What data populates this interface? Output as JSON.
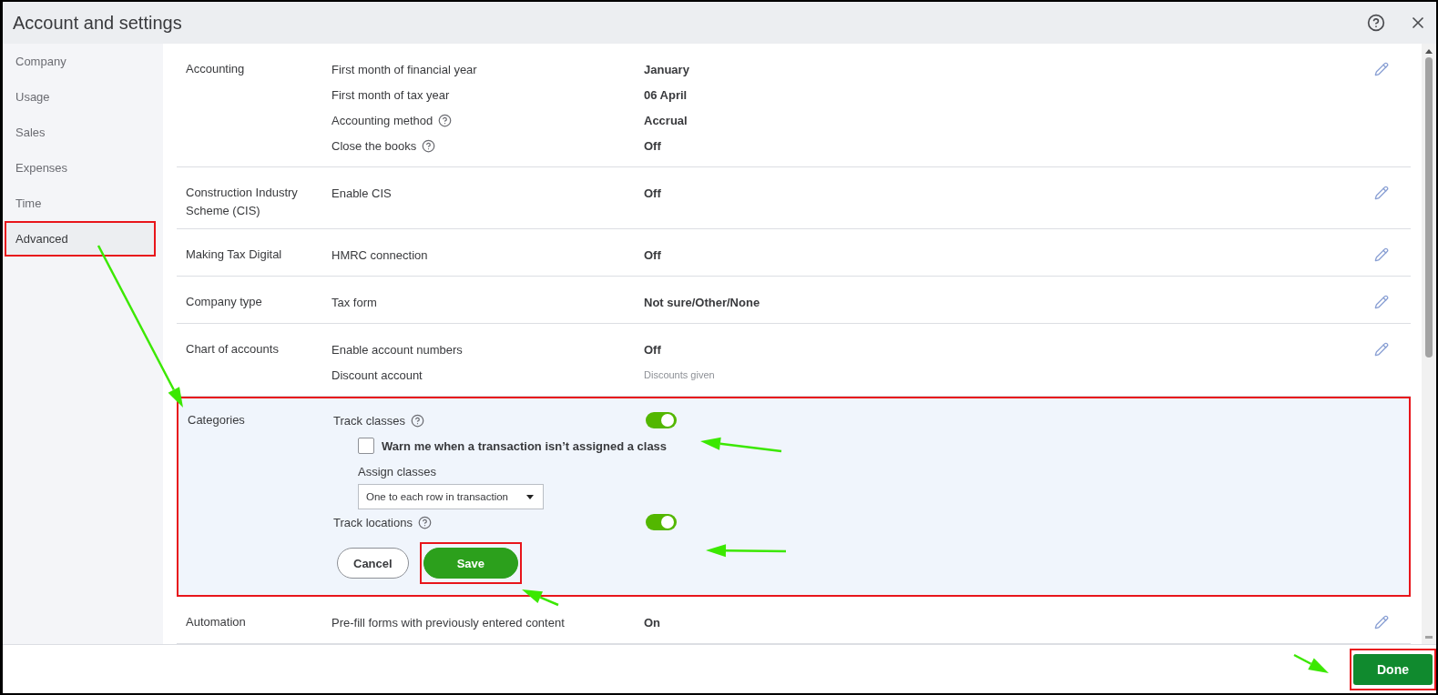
{
  "window": {
    "title": "Account and settings"
  },
  "sidebar": {
    "items": [
      {
        "label": "Company",
        "selected": false,
        "highlighted": false
      },
      {
        "label": "Usage",
        "selected": false,
        "highlighted": false
      },
      {
        "label": "Sales",
        "selected": false,
        "highlighted": false
      },
      {
        "label": "Expenses",
        "selected": false,
        "highlighted": false
      },
      {
        "label": "Time",
        "selected": false,
        "highlighted": false
      },
      {
        "label": "Advanced",
        "selected": true,
        "highlighted": true
      }
    ]
  },
  "sections": [
    {
      "kind": "info",
      "title": "Accounting",
      "editable": true,
      "highlighted": false,
      "rows": [
        {
          "label": "First month of financial year",
          "help": false,
          "value": "January",
          "muted": false
        },
        {
          "label": "First month of tax year",
          "help": false,
          "value": "06 April",
          "muted": false
        },
        {
          "label": "Accounting method",
          "help": true,
          "value": "Accrual",
          "muted": false
        },
        {
          "label": "Close the books",
          "help": true,
          "value": "Off",
          "muted": false
        }
      ]
    },
    {
      "kind": "info",
      "title": "Construction Industry Scheme (CIS)",
      "editable": true,
      "highlighted": false,
      "rows": [
        {
          "label": "Enable CIS",
          "help": false,
          "value": "Off",
          "muted": false
        }
      ]
    },
    {
      "kind": "info",
      "title": "Making Tax Digital",
      "editable": true,
      "highlighted": false,
      "rows": [
        {
          "label": "HMRC connection",
          "help": false,
          "value": "Off",
          "muted": false
        }
      ]
    },
    {
      "kind": "info",
      "title": "Company type",
      "editable": true,
      "highlighted": false,
      "rows": [
        {
          "label": "Tax form",
          "help": false,
          "value": "Not sure/Other/None",
          "muted": false
        }
      ]
    },
    {
      "kind": "info",
      "title": "Chart of accounts",
      "editable": true,
      "highlighted": false,
      "rows": [
        {
          "label": "Enable account numbers",
          "help": false,
          "value": "Off",
          "muted": false
        },
        {
          "label": "Discount account",
          "help": false,
          "value": "Discounts given",
          "muted": true
        }
      ]
    },
    {
      "kind": "form",
      "title": "Categories",
      "editable": false,
      "highlighted": true,
      "fields": [
        {
          "kind": "toggle",
          "label": "Track classes",
          "help": true,
          "on": true
        },
        {
          "kind": "checkbox",
          "label": "Warn me when a transaction isn’t assigned a class",
          "checked": false
        },
        {
          "kind": "caption",
          "label": "Assign classes"
        },
        {
          "kind": "select",
          "value": "One to each row in transaction"
        },
        {
          "kind": "toggle",
          "label": "Track locations",
          "help": true,
          "on": true
        }
      ],
      "buttons": [
        {
          "label": "Cancel",
          "kind": "secondary",
          "highlighted": false
        },
        {
          "label": "Save",
          "kind": "primary",
          "highlighted": true
        }
      ]
    },
    {
      "kind": "info",
      "title": "Automation",
      "editable": true,
      "highlighted": false,
      "rows": [
        {
          "label": "Pre-fill forms with previously entered content",
          "help": false,
          "value": "On",
          "muted": false
        }
      ]
    }
  ],
  "footer": {
    "buttons": [
      {
        "label": "Done",
        "highlighted": true
      }
    ]
  }
}
